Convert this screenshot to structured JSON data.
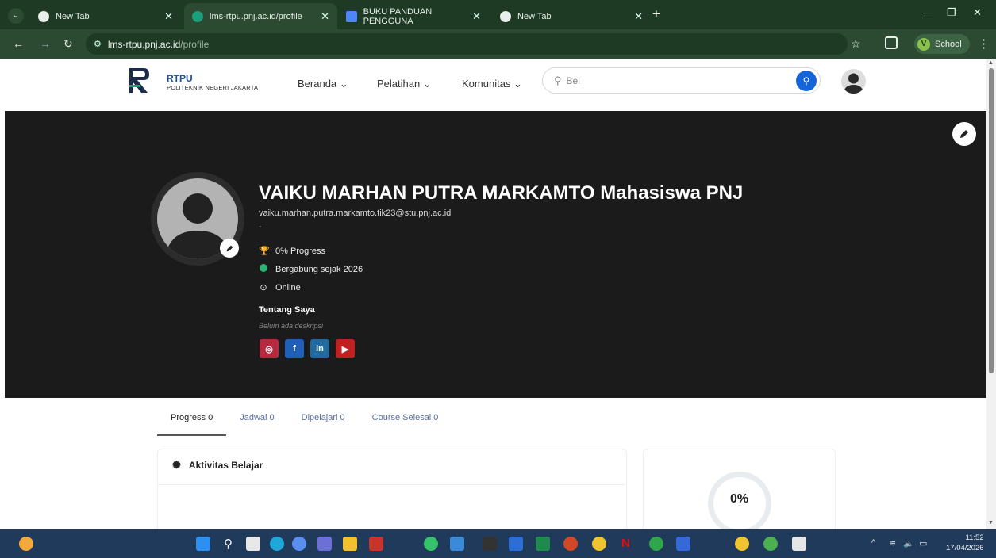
{
  "browser": {
    "tabs": [
      {
        "title": "New Tab",
        "active": false
      },
      {
        "title": "lms-rtpu.pnj.ac.id/profile",
        "active": true
      },
      {
        "title": "BUKU PANDUAN PENGGUNA",
        "active": false
      },
      {
        "title": "New Tab",
        "active": false
      }
    ],
    "url_host": "lms-rtpu.pnj.ac.id",
    "url_path": "/profile",
    "profile_label": "School",
    "profile_initial": "V"
  },
  "site": {
    "logo_title": "RTPU",
    "logo_subtitle": "POLITEKNIK NEGERI JAKARTA",
    "menu": [
      {
        "label": "Beranda ⌄"
      },
      {
        "label": "Pelatihan ⌄"
      },
      {
        "label": "Komunitas ⌄"
      }
    ],
    "search_value": "Bel"
  },
  "profile": {
    "name": "VAIKU MARHAN PUTRA MARKAMTO Mahasiswa PNJ",
    "email": "vaiku.marhan.putra.markamto.tik23@stu.pnj.ac.id",
    "subtitle": "-",
    "progress": "0% Progress",
    "joined": "Bergabung sejak 2026",
    "status": "Online",
    "about_title": "Tentang Saya",
    "about_desc": "Belum ada deskripsi"
  },
  "profile_tabs": [
    {
      "label": "Progress 0",
      "active": true
    },
    {
      "label": "Jadwal 0",
      "active": false
    },
    {
      "label": "Dipelajari 0",
      "active": false
    },
    {
      "label": "Course Selesai 0",
      "active": false
    }
  ],
  "activity_card": {
    "title": "Aktivitas Belajar"
  },
  "progress_card": {
    "percent_label": "0%"
  },
  "taskbar": {
    "time": "11:52",
    "date": "17/04/2026"
  },
  "colors": {
    "browser_frame": "#1e3a24",
    "hero_bg": "#1b1b1b",
    "brand_blue": "#1664d9",
    "instagram": "#b8283f",
    "facebook": "#1f5fb8",
    "linkedin": "#1f6aa0",
    "youtube": "#c02020"
  }
}
